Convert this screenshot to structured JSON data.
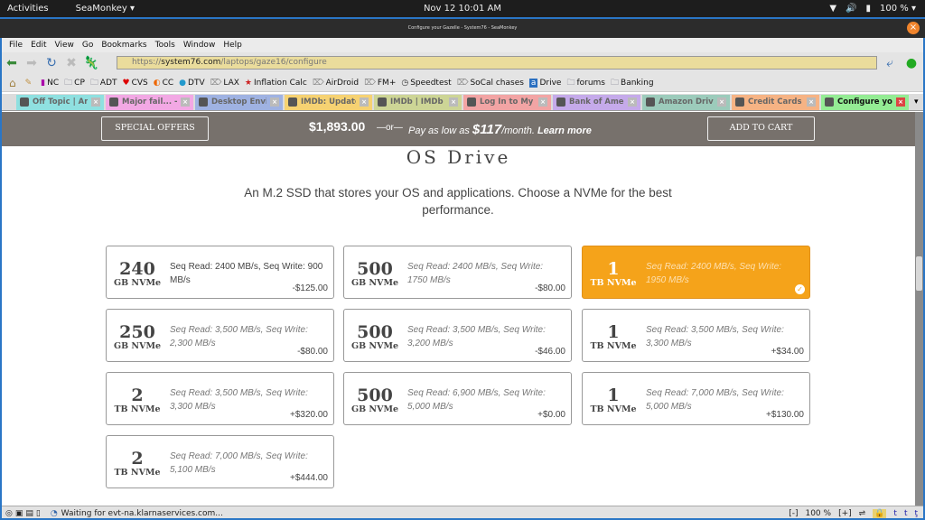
{
  "system_bar": {
    "activities": "Activities",
    "app_menu": "SeaMonkey ▾",
    "clock": "Nov 12  10:01 AM",
    "battery": "100 % ▾"
  },
  "window": {
    "title": "Configure your Gazelle - System76 - SeaMonkey"
  },
  "menu": [
    "File",
    "Edit",
    "View",
    "Go",
    "Bookmarks",
    "Tools",
    "Window",
    "Help"
  ],
  "address_bar": {
    "scheme": "https://",
    "domain": "system76.com",
    "path": "/laptops/gaze16/configure"
  },
  "bookmarks": [
    {
      "label": "NC",
      "icon": "nc-favicon"
    },
    {
      "label": "CP",
      "icon": "folder-icon"
    },
    {
      "label": "ADT",
      "icon": "folder-icon"
    },
    {
      "label": "CVS",
      "icon": "heart-icon"
    },
    {
      "label": "CC",
      "icon": "cc-favicon"
    },
    {
      "label": "DTV",
      "icon": "globe-icon"
    },
    {
      "label": "LAX",
      "icon": "bookmark-tag-icon"
    },
    {
      "label": "Inflation Calc",
      "icon": "star-icon"
    },
    {
      "label": "AirDroid",
      "icon": "bookmark-tag-icon"
    },
    {
      "label": "FM+",
      "icon": "bookmark-tag-icon"
    },
    {
      "label": "Speedtest",
      "icon": "gauge-icon"
    },
    {
      "label": "SoCal chases",
      "icon": "bookmark-tag-icon"
    },
    {
      "label": "Drive",
      "icon": "amazon-icon"
    },
    {
      "label": "forums",
      "icon": "folder-icon"
    },
    {
      "label": "Banking",
      "icon": "folder-icon"
    }
  ],
  "tabs": [
    {
      "label": "Off Topic | An...",
      "color": "#8fe0e0"
    },
    {
      "label": "Major fail... - ...",
      "color": "#f2a8e4"
    },
    {
      "label": "Desktop Envir...",
      "color": "#9fb2e2"
    },
    {
      "label": "IMDb: Update ...",
      "color": "#f6d272"
    },
    {
      "label": "IMDb | IMDb C...",
      "color": "#cdd596"
    },
    {
      "label": "Log In to My A...",
      "color": "#f2a4a4"
    },
    {
      "label": "Bank of Ameri...",
      "color": "#c5aaea"
    },
    {
      "label": "Amazon Drive",
      "color": "#9ccbbb"
    },
    {
      "label": "Credit Cards - ...",
      "color": "#f6b384"
    },
    {
      "label": "Configure you...",
      "color": "#94ec94",
      "active": true
    }
  ],
  "sticky_bar": {
    "special_offers": "SPECIAL OFFERS",
    "price": "$1,893.00",
    "or": "—or—",
    "pay_prefix": "Pay as low as ",
    "monthly": "$117",
    "per_month": "/month. ",
    "learn_more": "Learn more",
    "add_to_cart": "ADD TO CART"
  },
  "section": {
    "title": "OS Drive",
    "description": "An M.2 SSD that stores your OS and applications. Choose a NVMe for the best performance."
  },
  "drives": [
    {
      "capacity": "240",
      "unit": "GB NVMe",
      "spec": "Seq Read: 2400 MB/s, Seq Write: 900 MB/s",
      "delta": "-$125.00"
    },
    {
      "capacity": "500",
      "unit": "GB NVMe",
      "spec": "Seq Read: 2400 MB/s, Seq Write: 1750 MB/s",
      "delta": "-$80.00"
    },
    {
      "capacity": "1",
      "unit": "TB NVMe",
      "spec": "Seq Read: 2400 MB/s, Seq Write: 1950 MB/s",
      "delta": "",
      "selected": true
    },
    {
      "capacity": "250",
      "unit": "GB NVMe",
      "spec": "Seq Read: 3,500 MB/s, Seq Write: 2,300 MB/s",
      "delta": "-$80.00"
    },
    {
      "capacity": "500",
      "unit": "GB NVMe",
      "spec": "Seq Read: 3,500 MB/s, Seq Write: 3,200 MB/s",
      "delta": "-$46.00"
    },
    {
      "capacity": "1",
      "unit": "TB NVMe",
      "spec": "Seq Read: 3,500 MB/s, Seq Write: 3,300 MB/s",
      "delta": "+$34.00"
    },
    {
      "capacity": "2",
      "unit": "TB NVMe",
      "spec": "Seq Read: 3,500 MB/s, Seq Write: 3,300 MB/s",
      "delta": "+$320.00"
    },
    {
      "capacity": "500",
      "unit": "GB NVMe",
      "spec": "Seq Read: 6,900 MB/s, Seq Write: 5,000 MB/s",
      "delta": "+$0.00"
    },
    {
      "capacity": "1",
      "unit": "TB NVMe",
      "spec": "Seq Read: 7,000 MB/s, Seq Write: 5,000 MB/s",
      "delta": "+$130.00"
    },
    {
      "capacity": "2",
      "unit": "TB NVMe",
      "spec": "Seq Read: 7,000 MB/s, Seq Write: 5,100 MB/s",
      "delta": "+$444.00"
    }
  ],
  "accent_color": "#f5a31a",
  "status_bar": {
    "message": "Waiting for evt-na.klarnaservices.com...",
    "zoom_out": "[-]",
    "zoom": "100 %",
    "zoom_in": "[+]"
  }
}
